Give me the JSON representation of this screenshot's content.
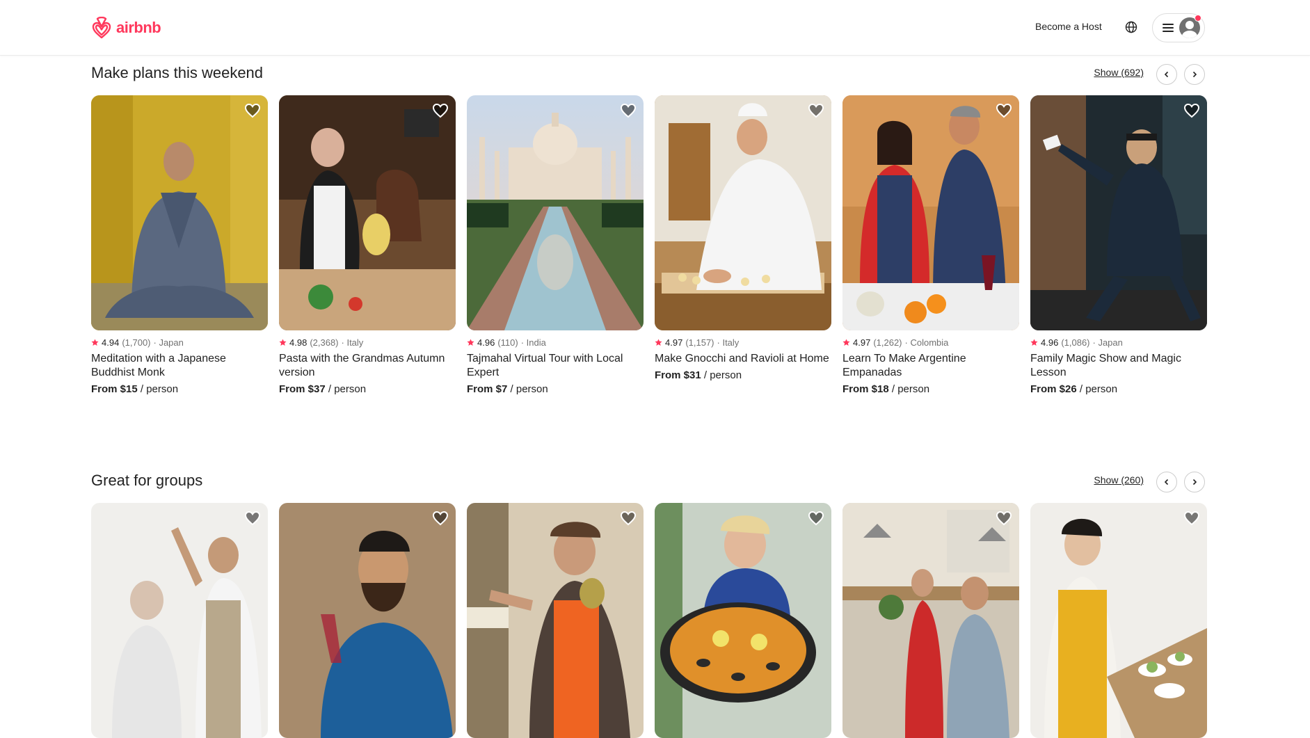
{
  "header": {
    "logo_text": "airbnb",
    "become_host": "Become a Host",
    "brand_color": "#ff385c"
  },
  "sections": [
    {
      "title": "Make plans this weekend",
      "show": "Show (692)",
      "cards": [
        {
          "rating": "4.94",
          "reviews": "(1,700)",
          "location": "· Japan",
          "title": "Meditation with a Japanese Buddhist Monk",
          "price": "From $15",
          "per": " / person"
        },
        {
          "rating": "4.98",
          "reviews": "(2,368)",
          "location": "· Italy",
          "title": "Pasta with the Grandmas Autumn version",
          "price": "From $37",
          "per": " / person"
        },
        {
          "rating": "4.96",
          "reviews": "(110)",
          "location": "· India",
          "title": "Tajmahal Virtual Tour with Local Expert",
          "price": "From $7",
          "per": " / person"
        },
        {
          "rating": "4.97",
          "reviews": "(1,157)",
          "location": "· Italy",
          "title": "Make Gnocchi and Ravioli at Home",
          "price": "From $31",
          "per": " / person"
        },
        {
          "rating": "4.97",
          "reviews": "(1,262)",
          "location": "· Colombia",
          "title": "Learn To Make Argentine Empanadas",
          "price": "From $18",
          "per": " / person"
        },
        {
          "rating": "4.96",
          "reviews": "(1,086)",
          "location": "· Japan",
          "title": "Family Magic Show and Magic Lesson",
          "price": "From $26",
          "per": " / person"
        }
      ]
    },
    {
      "title": "Great for groups",
      "show": "Show (260)"
    }
  ]
}
